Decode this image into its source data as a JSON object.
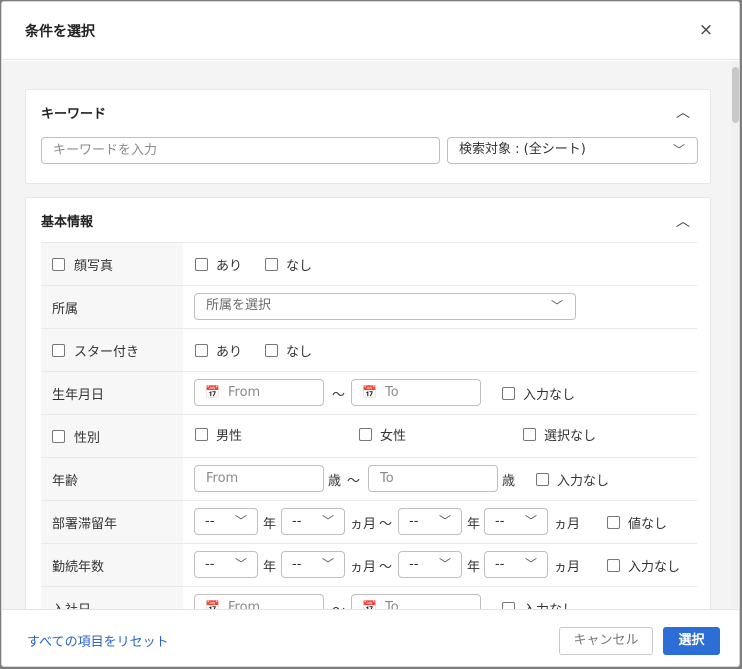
{
  "dialog": {
    "title": "条件を選択",
    "close_icon": "×"
  },
  "keyword_section": {
    "title": "キーワード",
    "input_placeholder": "キーワードを入力",
    "search_target": "検索対象 : (全シート)"
  },
  "basic_section": {
    "title": "基本情報",
    "rows": {
      "photo": {
        "label": "顔写真",
        "opt_yes": "あり",
        "opt_no": "なし"
      },
      "affiliation": {
        "label": "所属",
        "placeholder": "所属を選択"
      },
      "starred": {
        "label": "スター付き",
        "opt_yes": "あり",
        "opt_no": "なし"
      },
      "birthdate": {
        "label": "生年月日",
        "from": "From",
        "to": "To",
        "tilde": "～",
        "no_input": "入力なし"
      },
      "gender": {
        "label": "性別",
        "male": "男性",
        "female": "女性",
        "none": "選択なし"
      },
      "age": {
        "label": "年齢",
        "from": "From",
        "to": "To",
        "unit": "歳",
        "tilde": "～",
        "no_input": "入力なし"
      },
      "dept_stay": {
        "label": "部署滞留年",
        "sel": "--",
        "year": "年",
        "month": "ヵ月",
        "tilde": "～",
        "none_label": "値なし"
      },
      "tenure": {
        "label": "勤続年数",
        "sel": "--",
        "year": "年",
        "month": "ヵ月",
        "tilde": "～",
        "none_label": "入力なし"
      },
      "join_date": {
        "label": "入社日",
        "from": "From",
        "to": "To",
        "tilde": "～",
        "no_input": "入力なし"
      }
    }
  },
  "footer": {
    "reset_label": "すべての項目をリセット",
    "cancel_label": "キャンセル",
    "select_label": "選択"
  },
  "colors": {
    "accent": "#2c6ed5",
    "link": "#2a64c7",
    "overlay": "#7d7d7d"
  }
}
